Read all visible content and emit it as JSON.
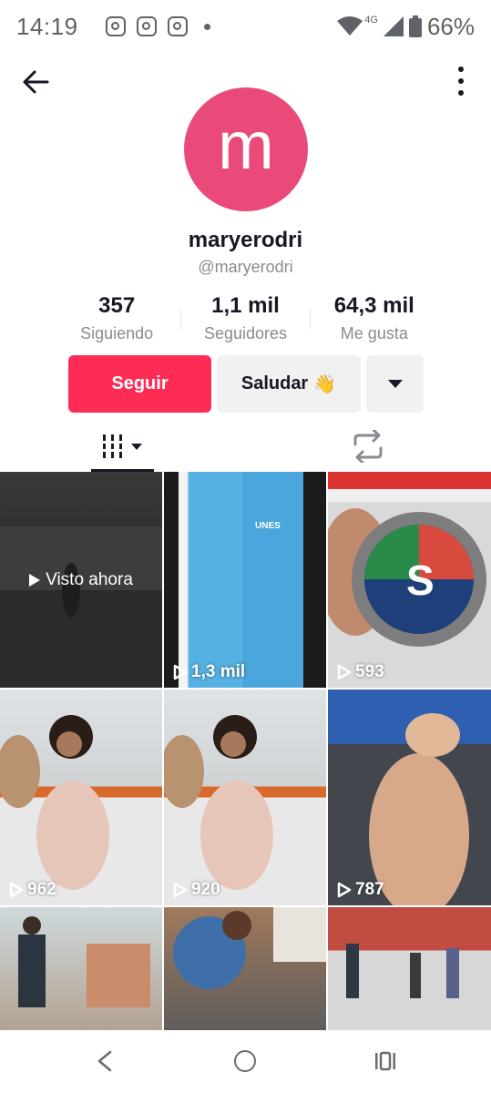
{
  "status_bar": {
    "time": "14:19",
    "network": "4G",
    "battery": "66%",
    "notification_icons": [
      "instagram-icon",
      "instagram-icon",
      "instagram-icon"
    ]
  },
  "profile": {
    "avatar_letter": "m",
    "avatar_color": "#ea4a7a",
    "username": "maryerodri",
    "handle": "@maryerodri"
  },
  "stats": [
    {
      "value": "357",
      "label": "Siguiendo"
    },
    {
      "value": "1,1 mil",
      "label": "Seguidores"
    },
    {
      "value": "64,3 mil",
      "label": "Me gusta"
    }
  ],
  "actions": {
    "follow": "Seguir",
    "message": "Saludar",
    "message_emoji": "👋"
  },
  "colors": {
    "accent": "#fe2c55",
    "secondary_button": "#f1f1f2"
  },
  "videos": [
    {
      "overlay": "Visto ahora",
      "views": null,
      "thumb_text": ""
    },
    {
      "overlay": null,
      "views": "1,3 mil",
      "thumb_text": "UNES"
    },
    {
      "overlay": null,
      "views": "593",
      "thumb_text": "S"
    },
    {
      "overlay": null,
      "views": "962",
      "thumb_text": ""
    },
    {
      "overlay": null,
      "views": "920",
      "thumb_text": ""
    },
    {
      "overlay": null,
      "views": "787",
      "thumb_text": ""
    },
    {
      "overlay": null,
      "views": null,
      "thumb_text": ""
    },
    {
      "overlay": null,
      "views": null,
      "thumb_text": ""
    },
    {
      "overlay": null,
      "views": null,
      "thumb_text": ""
    }
  ]
}
